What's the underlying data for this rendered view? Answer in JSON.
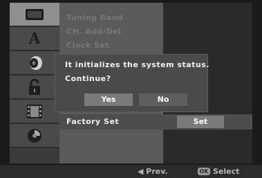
{
  "sidebar": {
    "icons": [
      {
        "name": "tv-icon",
        "active": true
      },
      {
        "name": "language-icon",
        "glyph": "A",
        "active": false
      },
      {
        "name": "speaker-icon",
        "active": false
      },
      {
        "name": "lock-icon",
        "active": false
      },
      {
        "name": "film-icon",
        "active": false
      },
      {
        "name": "disc-icon",
        "active": false
      }
    ]
  },
  "menu": {
    "items": [
      "Tuning Band",
      "CH. Add/Del",
      "Clock Set"
    ],
    "selected_label": "Factory Set",
    "selected_value": "Set"
  },
  "dialog": {
    "line1": "It initializes the system status.",
    "line2": "Continue?",
    "yes_label": "Yes",
    "no_label": "No"
  },
  "footer": {
    "prev_label": "◀ Prev.",
    "ok_label": "OK",
    "select_label": "Select"
  },
  "colors": {
    "panel": "#5a5a5a",
    "highlight": "#7b7b7b",
    "text": "#f0f0f0"
  }
}
